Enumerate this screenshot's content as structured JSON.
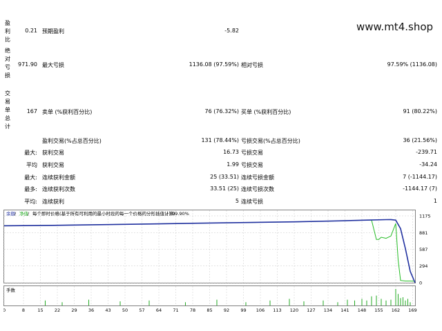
{
  "watermark": "www.mt4.shop",
  "profit_factor": {
    "label_chars": [
      "盈",
      "利",
      "比"
    ],
    "value": "0.21",
    "expected_label": "预期盈利",
    "expected_value": "-5.82"
  },
  "drawdown": {
    "label_chars": [
      "绝",
      "对",
      "亏",
      "损"
    ],
    "value": "971.90",
    "max_label": "最大亏损",
    "max_value": "1136.08 (97.59%)",
    "rel_label": "相对亏损",
    "rel_value": "97.59% (1136.08)"
  },
  "trades": {
    "label_chars": [
      "交",
      "易",
      "单",
      "总",
      "计"
    ],
    "value": "167",
    "sell_label": "卖单 (%获利百分比)",
    "sell_value": "76 (76.32%)",
    "buy_label": "买单 (%获利百分比)",
    "buy_value": "91 (80.22%)"
  },
  "rows": [
    {
      "prefix": "",
      "l1": "盈利交易(%占总百分比)",
      "v1": "131 (78.44%)",
      "l2": "亏损交易(%占总百分比)",
      "v2": "36 (21.56%)"
    },
    {
      "prefix": "最大:",
      "l1": "获利交易",
      "v1": "16.73",
      "l2": "亏损交易",
      "v2": "-239.71"
    },
    {
      "prefix": "平均",
      "l1": "获利交易",
      "v1": "1.99",
      "l2": "亏损交易",
      "v2": "-34.24"
    },
    {
      "prefix": "最大:",
      "l1": "连续获利金额",
      "v1": "25 (33.51)",
      "l2": "连续亏损金额",
      "v2": "7 (-1144.17)"
    },
    {
      "prefix": "最多:",
      "l1": "连续获利次数",
      "v1": "33.51 (25)",
      "l2": "连续亏损次数",
      "v2": "-1144.17 (7)"
    },
    {
      "prefix": "平均:",
      "l1": "连续获利",
      "v1": "5",
      "l2": "连续亏损",
      "v2": "1"
    }
  ],
  "chart_legend": {
    "balance": "余额",
    "equity": "净值",
    "desc": "每个即时价格(基于所有可利用的最小时段的每一个价格的分形插值计算)",
    "quality": "99.90%"
  },
  "volume_label": "手数",
  "colors": {
    "balance": "#1f2f9f",
    "equity": "#22bb22",
    "grid": "#c8c8c8",
    "volume": "#22aa22"
  },
  "chart_data": {
    "type": "line",
    "ylim": [
      0,
      1175
    ],
    "y_ticks": [
      "1175",
      "881",
      "587",
      "294",
      "0"
    ],
    "x_ticks": [
      "0",
      "8",
      "15",
      "22",
      "29",
      "36",
      "43",
      "50",
      "57",
      "64",
      "71",
      "78",
      "85",
      "92",
      "99",
      "106",
      "113",
      "120",
      "127",
      "134",
      "141",
      "148",
      "155",
      "162",
      "169"
    ],
    "x_max": 170,
    "series": [
      {
        "name": "余额",
        "x": [
          0,
          20,
          40,
          60,
          80,
          100,
          120,
          140,
          150,
          158,
          160,
          162,
          164,
          166,
          168,
          170
        ],
        "y": [
          1000,
          1008,
          1020,
          1032,
          1045,
          1058,
          1070,
          1088,
          1100,
          1108,
          1110,
          1100,
          950,
          600,
          200,
          0
        ]
      },
      {
        "name": "净值",
        "x": [
          0,
          20,
          40,
          60,
          80,
          100,
          120,
          140,
          150,
          152,
          154,
          155,
          156,
          158,
          160,
          161,
          162,
          163,
          164,
          166,
          168,
          170
        ],
        "y": [
          1000,
          1008,
          1020,
          1032,
          1045,
          1058,
          1070,
          1088,
          1100,
          1100,
          760,
          760,
          800,
          780,
          820,
          930,
          1040,
          400,
          40,
          30,
          30,
          25
        ]
      }
    ],
    "volume_bars": [
      [
        17,
        0.3
      ],
      [
        24,
        0.2
      ],
      [
        35,
        0.35
      ],
      [
        48,
        0.25
      ],
      [
        60,
        0.3
      ],
      [
        75,
        0.2
      ],
      [
        88,
        0.35
      ],
      [
        100,
        0.2
      ],
      [
        110,
        0.3
      ],
      [
        118,
        0.4
      ],
      [
        124,
        0.25
      ],
      [
        132,
        0.3
      ],
      [
        138,
        0.2
      ],
      [
        142,
        0.35
      ],
      [
        145,
        0.3
      ],
      [
        148,
        0.4
      ],
      [
        150,
        0.3
      ],
      [
        152,
        0.55
      ],
      [
        154,
        0.6
      ],
      [
        156,
        0.4
      ],
      [
        158,
        0.3
      ],
      [
        160,
        0.35
      ],
      [
        162,
        1.0
      ],
      [
        163,
        0.7
      ],
      [
        164,
        0.45
      ],
      [
        165,
        0.5
      ],
      [
        166,
        0.3
      ],
      [
        167,
        0.4
      ],
      [
        168,
        0.2
      ]
    ]
  }
}
